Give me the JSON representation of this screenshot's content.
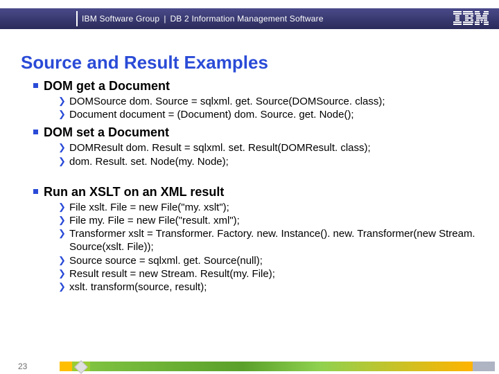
{
  "header": {
    "group": "IBM Software Group",
    "product": "DB 2 Information Management Software",
    "logo_label": "IBM"
  },
  "title": "Source and Result Examples",
  "sections": [
    {
      "heading": "DOM get a Document",
      "lines": [
        "DOMSource dom. Source = sqlxml. get. Source(DOMSource. class);",
        "Document document = (Document) dom. Source. get. Node();"
      ]
    },
    {
      "heading": "DOM set a Document",
      "lines": [
        "DOMResult dom. Result = sqlxml. set. Result(DOMResult. class);",
        "dom. Result. set. Node(my. Node);"
      ]
    },
    {
      "heading": "Run an XSLT on an XML result",
      "lines": [
        "File xslt. File = new File(\"my. xslt\");",
        "File my. File = new File(\"result. xml\");",
        "Transformer xslt = Transformer. Factory. new. Instance(). new. Transformer(new Stream. Source(xslt. File));",
        "Source source = sqlxml. get. Source(null);",
        "Result result = new Stream. Result(my. File);",
        "xslt. transform(source, result);"
      ]
    }
  ],
  "page_number": "23"
}
